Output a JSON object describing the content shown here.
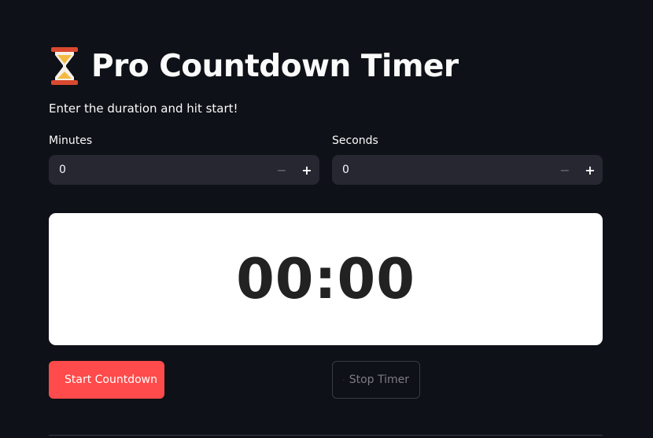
{
  "header": {
    "title": "Pro Countdown Timer",
    "icon": "hourglass-icon",
    "subtitle": "Enter the duration and hit start!"
  },
  "inputs": {
    "minutes": {
      "label": "Minutes",
      "value": "0"
    },
    "seconds": {
      "label": "Seconds",
      "value": "0"
    },
    "decrement_symbol": "−",
    "increment_symbol": "+"
  },
  "display": {
    "time": "00:00"
  },
  "buttons": {
    "start": {
      "label": "Start Countdown",
      "icon": "rocket-icon"
    },
    "stop": {
      "label": "Stop Timer",
      "icon": "red-circle-icon"
    }
  },
  "colors": {
    "background": "#0e1117",
    "input_background": "#262730",
    "primary": "#ff4b4b",
    "display_background": "#ffffff",
    "display_text": "#222222"
  }
}
